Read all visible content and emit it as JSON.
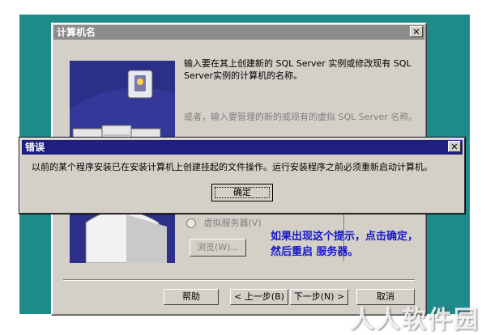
{
  "main_window": {
    "title": "计算机名",
    "close_symbol": "✕",
    "text1": "输入要在其上创建新的 SQL Server 实例或修改现有 SQL Server实例的计算机的名称。",
    "text2": "或者，输入要管理的新的或现有的虚拟 SQL Server 名称。",
    "virtual_server_label": "虚拟服务器(V)",
    "browse_label": "浏览(W)...",
    "buttons": {
      "help": "帮助",
      "back": "< 上一步(B)",
      "next": "下一步(N) >",
      "cancel": "取消"
    }
  },
  "error_dialog": {
    "title": "错误",
    "close_symbol": "✕",
    "message": "以前的某个程序安装已在安装计算机上创建挂起的文件操作。运行安装程序之前必须重新启动计算机。",
    "ok_label": "确定"
  },
  "annotation": {
    "line1": "如果出现这个提示，点击确定，",
    "line2": "然后重启 服务器。"
  },
  "watermark": "人人软件园",
  "colors": {
    "desktop": "#1f8a8a",
    "dialog_face": "#d4d0c8",
    "active_title": "#1f1f80",
    "inactive_title": "#8c8c8c",
    "annotation": "#1515c8"
  }
}
